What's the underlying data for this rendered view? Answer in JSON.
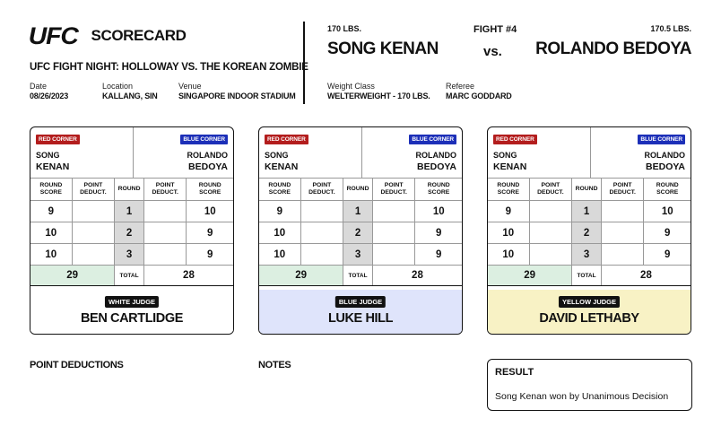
{
  "header": {
    "logo": "UFC",
    "title": "SCORECARD",
    "event": "UFC FIGHT NIGHT: HOLLOWAY VS. THE KOREAN ZOMBIE",
    "date_label": "Date",
    "date": "08/26/2023",
    "location_label": "Location",
    "location": "KALLANG, SIN",
    "venue_label": "Venue",
    "venue": "SINGAPORE INDOOR STADIUM"
  },
  "fight": {
    "number": "FIGHT #4",
    "red_weight": "170 LBS.",
    "blue_weight": "170.5 LBS.",
    "red_name": "SONG KENAN",
    "blue_name": "ROLANDO BEDOYA",
    "vs": "vs.",
    "weight_class_label": "Weight Class",
    "weight_class": "WELTERWEIGHT - 170 LBS.",
    "referee_label": "Referee",
    "referee": "MARC GODDARD"
  },
  "labels": {
    "red_corner": "RED CORNER",
    "blue_corner": "BLUE CORNER",
    "red_first": "SONG",
    "red_last": "KENAN",
    "blue_first": "ROLANDO",
    "blue_last": "BEDOYA",
    "round_score": "ROUND SCORE",
    "point_deduct": "POINT DEDUCT.",
    "round": "ROUND",
    "total": "TOTAL"
  },
  "cards": [
    {
      "judge_title": "WHITE JUDGE",
      "judge_name": "BEN CARTLIDGE",
      "color": "#ffffff",
      "rounds": [
        {
          "red": "9",
          "red_ded": "",
          "round": "1",
          "blue_ded": "",
          "blue": "10"
        },
        {
          "red": "10",
          "red_ded": "",
          "round": "2",
          "blue_ded": "",
          "blue": "9"
        },
        {
          "red": "10",
          "red_ded": "",
          "round": "3",
          "blue_ded": "",
          "blue": "9"
        }
      ],
      "red_total": "29",
      "blue_total": "28"
    },
    {
      "judge_title": "BLUE JUDGE",
      "judge_name": "LUKE HILL",
      "color": "#dfe4fb",
      "rounds": [
        {
          "red": "9",
          "red_ded": "",
          "round": "1",
          "blue_ded": "",
          "blue": "10"
        },
        {
          "red": "10",
          "red_ded": "",
          "round": "2",
          "blue_ded": "",
          "blue": "9"
        },
        {
          "red": "10",
          "red_ded": "",
          "round": "3",
          "blue_ded": "",
          "blue": "9"
        }
      ],
      "red_total": "29",
      "blue_total": "28"
    },
    {
      "judge_title": "YELLOW JUDGE",
      "judge_name": "DAVID LETHABY",
      "color": "#f8f2c5",
      "rounds": [
        {
          "red": "9",
          "red_ded": "",
          "round": "1",
          "blue_ded": "",
          "blue": "10"
        },
        {
          "red": "10",
          "red_ded": "",
          "round": "2",
          "blue_ded": "",
          "blue": "9"
        },
        {
          "red": "10",
          "red_ded": "",
          "round": "3",
          "blue_ded": "",
          "blue": "9"
        }
      ],
      "red_total": "29",
      "blue_total": "28"
    }
  ],
  "footer": {
    "point_deductions": "POINT DEDUCTIONS",
    "notes": "NOTES",
    "result_title": "RESULT",
    "result_text": "Song Kenan won by Unanimous Decision"
  },
  "colors": {
    "red_corner": "#b31d1d",
    "blue_corner": "#1c2fb8",
    "winner_total": "#dcefe1",
    "round_cell": "#d9d9d9"
  }
}
